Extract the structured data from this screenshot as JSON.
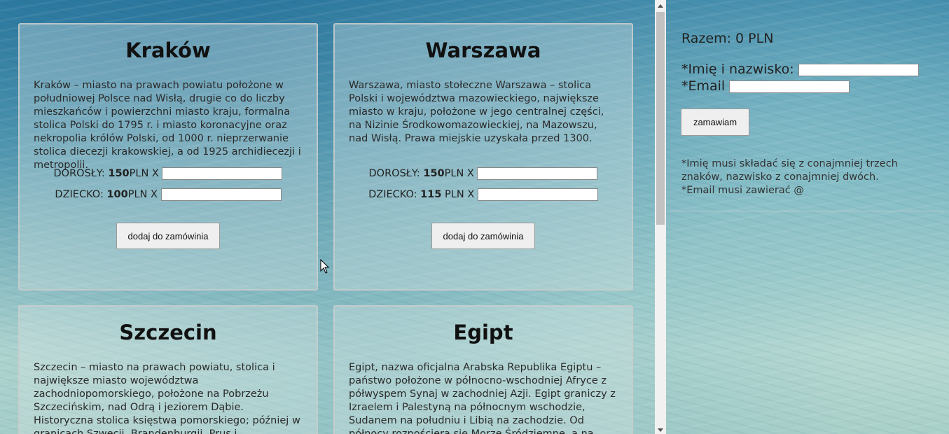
{
  "cards": [
    {
      "title": "Kraków",
      "description": "Kraków – miasto na prawach powiatu położone w południowej Polsce nad Wisłą, drugie co do liczby mieszkańców i powierzchni miasto kraju, formalna stolica Polski do 1795 r. i miasto koronacyjne oraz nekropolia królów Polski, od 1000 r. nieprzerwanie stolica diecezji krakowskiej, a od 1925 archidiecezji i metropolii.",
      "adult_label": "DOROSŁY: ",
      "adult_price": "150",
      "adult_suffix": "PLN X ",
      "child_label": "DZIECKO: ",
      "child_price": "100",
      "child_suffix": "PLN X ",
      "button": "dodaj do zamówinia"
    },
    {
      "title": "Warszawa",
      "description": "Warszawa, miasto stołeczne Warszawa – stolica Polski i województwa mazowieckiego, największe miasto w kraju, położone w jego centralnej części, na Nizinie Środkowomazowieckiej, na Mazowszu, nad Wisłą. Prawa miejskie uzyskała przed 1300.",
      "adult_label": "DOROSŁY: ",
      "adult_price": "150",
      "adult_suffix": "PLN X ",
      "child_label": "DZIECKO: ",
      "child_price": "115",
      "child_suffix": " PLN X ",
      "button": "dodaj do zamówinia"
    },
    {
      "title": "Szczecin",
      "description": "Szczecin – miasto na prawach powiatu, stolica i największe miasto województwa zachodniopomorskiego, położone na Pobrzeżu Szczecińskim, nad Odrą i jeziorem Dąbie. Historyczna stolica księstwa pomorskiego; później w granicach Szwecji, Brandenburgii, Prus i"
    },
    {
      "title": "Egipt",
      "description": "Egipt, nazwa oficjalna Arabska Republika Egiptu – państwo położone w północno-wschodniej Afryce z półwyspem Synaj w zachodniej Azji. Egipt graniczy z Izraelem i Palestyną na północnym wschodzie, Sudanem na południu i Libią na zachodzie. Od północy rozpościera się Morze Śródziemne, a na"
    }
  ],
  "sidebar": {
    "total": "Razem: 0 PLN",
    "name_label": "*Imię i nazwisko: ",
    "email_label": "*Email ",
    "order_button": "zamawiam",
    "hint_name": "*Imię musi składać się z conajmniej trzech znaków, nazwisko z conajmniej dwóch.",
    "hint_email": "*Email musi zawierać @"
  }
}
